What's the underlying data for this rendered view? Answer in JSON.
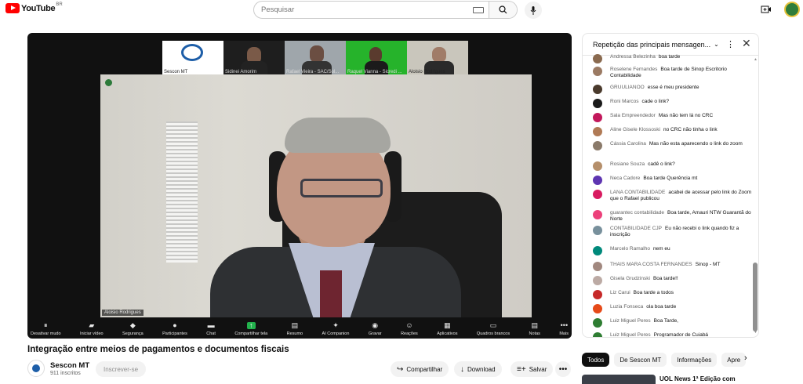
{
  "header": {
    "logo_text": "YouTube",
    "country_code": "BR",
    "search_placeholder": "Pesquisar"
  },
  "player": {
    "participants": [
      {
        "name": "Sescon MT"
      },
      {
        "name": "Sidinei Amorim"
      },
      {
        "name": "Rafael Vieira - SAC/Sol..."
      },
      {
        "name": "Raquel Vianna - Sicredi ..."
      },
      {
        "name": "Aloisio Rodrigues"
      }
    ],
    "main_speaker": "Aloisio Rodrigues",
    "toolbar": [
      {
        "label": "Desativar mudo",
        "icon": "mic-off-icon"
      },
      {
        "label": "Iniciar vídeo",
        "icon": "video-off-icon"
      },
      {
        "label": "Segurança",
        "icon": "shield-icon"
      },
      {
        "label": "Participantes",
        "icon": "people-icon",
        "count": "5"
      },
      {
        "label": "Chat",
        "icon": "chat-icon"
      },
      {
        "label": "Compartilhar tela",
        "icon": "share-screen-icon"
      },
      {
        "label": "Resumo",
        "icon": "summary-icon"
      },
      {
        "label": "AI Companion",
        "icon": "sparkle-icon"
      },
      {
        "label": "Gravar",
        "icon": "record-icon"
      },
      {
        "label": "Reações",
        "icon": "reactions-icon"
      },
      {
        "label": "Aplicativos",
        "icon": "apps-icon"
      },
      {
        "label": "Quadros brancos",
        "icon": "whiteboard-icon"
      },
      {
        "label": "Notas",
        "icon": "notes-icon"
      },
      {
        "label": "Mais",
        "icon": "more-icon"
      }
    ]
  },
  "video": {
    "title": "Integração entre meios de pagamentos e documentos fiscais",
    "channel": "Sescon MT",
    "subscribers": "911 inscritos",
    "subscribe_label": "Inscrever-se",
    "actions": {
      "share": "Compartilhar",
      "download": "Download",
      "save": "Salvar"
    }
  },
  "chat": {
    "header": "Repetição das principais mensagen...",
    "messages": [
      {
        "author": "Andressa Belezinha",
        "text": "boa tarde",
        "color": "#8a6a4f"
      },
      {
        "author": "Roselene Fernandes",
        "text": "Boa tarde de Sinop Escritorio Contabilidade",
        "color": "#9b7a63"
      },
      {
        "author": "GRUULIANOO",
        "text": "esse é meu presidente",
        "color": "#4a3a2c"
      },
      {
        "author": "Roni Marcos",
        "text": "cade o link?",
        "color": "#1a1a1a"
      },
      {
        "author": "Sala Empreendedor",
        "text": "Mas não tem lá no CRC",
        "color": "#c2185b"
      },
      {
        "author": "Aline Gisele Klossoski",
        "text": "no CRC não tinha o link",
        "color": "#b07a55"
      },
      {
        "author": "Cássia Carolina",
        "text": "Mas não esta aparecendo o link do zoom",
        "color": "#8a7a6a"
      },
      {
        "author": "Rosiane Souza",
        "text": "cadê o link?",
        "color": "#b58f6b"
      },
      {
        "author": "Neca Cadore",
        "text": "Boa tarde Querência mt",
        "color": "#5e35b1"
      },
      {
        "author": "LANA CONTABILIDADE",
        "text": "acabei de acessar pelo link do Zoom que o Rafael publicou",
        "color": "#d81b60"
      },
      {
        "author": "guarantec contabilidade",
        "text": "Boa tarde, Amauri NTW Guarantã do Norte",
        "color": "#ec407a"
      },
      {
        "author": "CONTABILIDADE CJP",
        "text": "Eu não recebi o link quando fiz a inscrição",
        "color": "#78909c"
      },
      {
        "author": "Marcelo Ramalho",
        "text": "nem eu",
        "color": "#00897b"
      },
      {
        "author": "THAIS MARA COSTA FERNANDES",
        "text": "Sinop - MT",
        "color": "#a1887f"
      },
      {
        "author": "Gisela Grudzinski",
        "text": "Boa tarde!!",
        "color": "#bcaaa4"
      },
      {
        "author": "Liz Carui",
        "text": "Boa tarde a todos",
        "color": "#c62828"
      },
      {
        "author": "Luzia Fonseca",
        "text": "ola boa tarde",
        "color": "#e64a19"
      },
      {
        "author": "Luiz Miguel Peres",
        "text": "Boa Tarde,",
        "color": "#2e7d32"
      },
      {
        "author": "Luiz Miguel Peres",
        "text": "Programador de Cuiabá",
        "color": "#2e7d32"
      }
    ]
  },
  "recommendations": {
    "chips": [
      "Todos",
      "De Sescon MT",
      "Informações",
      "Apre"
    ],
    "first_title": "UOL News 1ª Edição com"
  }
}
